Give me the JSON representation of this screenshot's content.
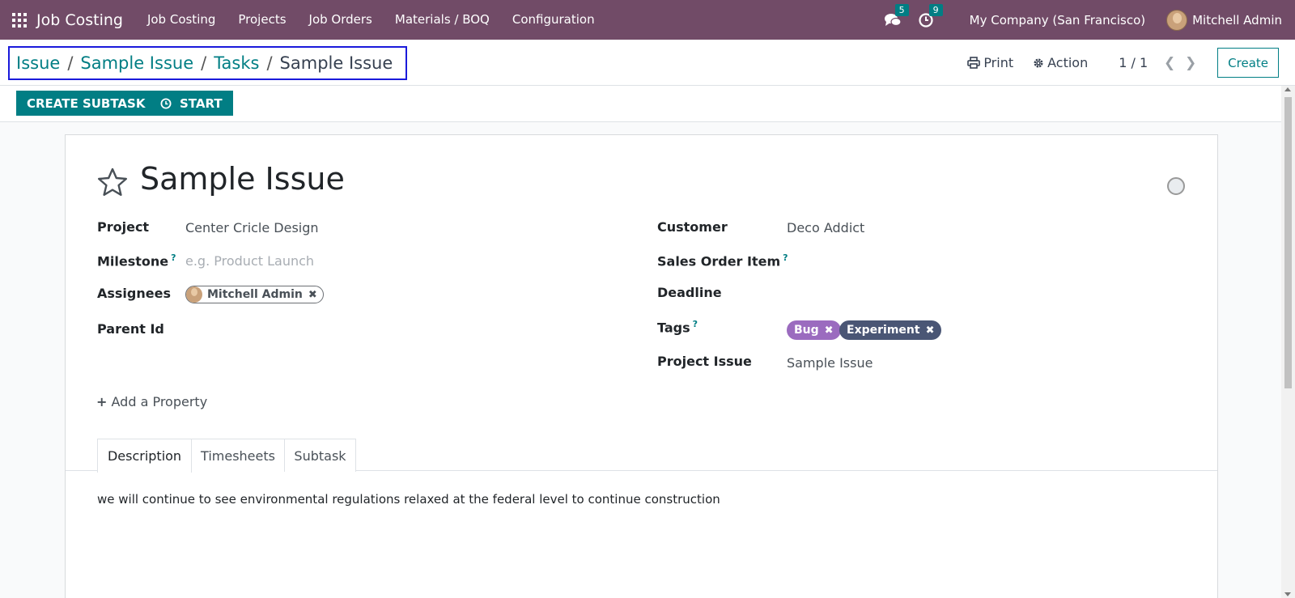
{
  "navbar": {
    "brand": "Job Costing",
    "menu": [
      "Job Costing",
      "Projects",
      "Job Orders",
      "Materials / BOQ",
      "Configuration"
    ],
    "messages_count": "5",
    "activities_count": "9",
    "company": "My Company (San Francisco)",
    "user": "Mitchell Admin"
  },
  "breadcrumb": {
    "items": [
      "Issue",
      "Sample Issue",
      "Tasks"
    ],
    "separator": "/",
    "current": "Sample Issue"
  },
  "control_panel": {
    "print_label": "Print",
    "action_label": "Action",
    "pager": "1 / 1",
    "create_label": "Create"
  },
  "statusbar": {
    "create_subtask_label": "CREATE SUBTASK",
    "start_label": "START"
  },
  "form": {
    "title": "Sample Issue",
    "left": {
      "project_label": "Project",
      "project_value": "Center Cricle Design",
      "milestone_label": "Milestone",
      "milestone_placeholder": "e.g. Product Launch",
      "assignees_label": "Assignees",
      "assignee": "Mitchell Admin",
      "parent_label": "Parent Id"
    },
    "right": {
      "customer_label": "Customer",
      "customer_value": "Deco Addict",
      "sales_order_item_label": "Sales Order Item",
      "deadline_label": "Deadline",
      "tags_label": "Tags",
      "tags": [
        {
          "name": "Bug",
          "color": "#9b6bbf"
        },
        {
          "name": "Experiment",
          "color": "#4a5675"
        }
      ],
      "project_issue_label": "Project Issue",
      "project_issue_value": "Sample Issue"
    },
    "help_mark": "?",
    "add_property_label": "Add a Property",
    "tabs": [
      "Description",
      "Timesheets",
      "Subtask"
    ],
    "active_tab": "Description",
    "description": "we will continue to see environmental regulations relaxed at the federal level to continue construction"
  },
  "colors": {
    "navbar": "#714b67",
    "accent": "#017e84",
    "breadcrumb_highlight": "#1a1adb"
  }
}
